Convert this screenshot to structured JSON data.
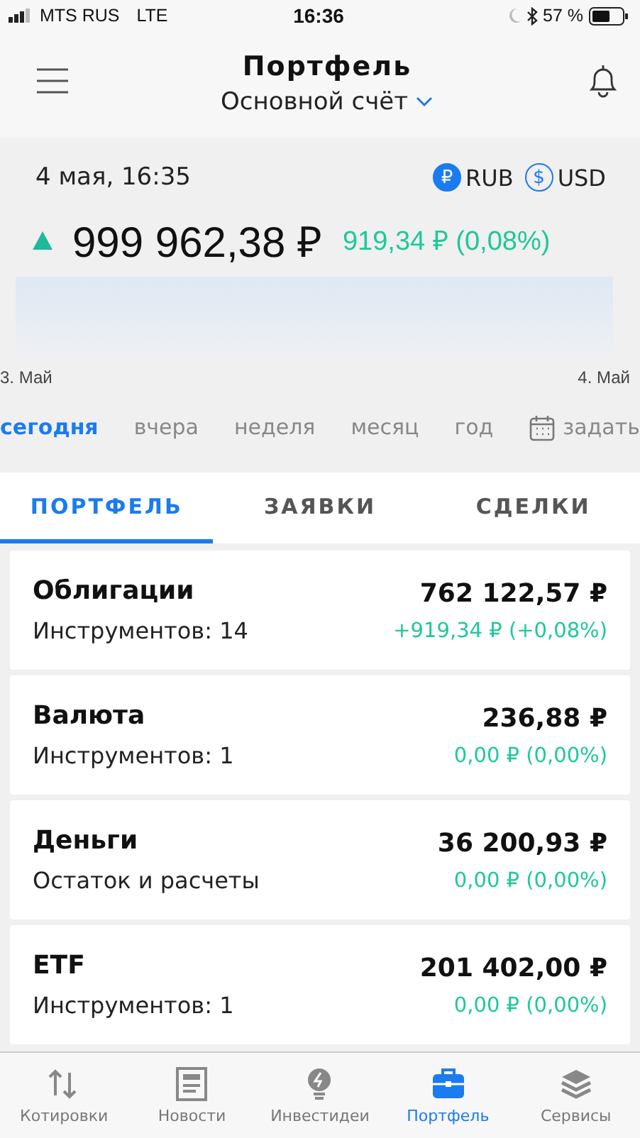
{
  "status_bar": {
    "carrier": "MTS RUS",
    "network": "LTE",
    "time": "16:36",
    "battery": "57 %"
  },
  "header": {
    "title": "Портфель",
    "account": "Основной счёт"
  },
  "summary": {
    "date": "4 мая, 16:35",
    "currencies": [
      {
        "symbol": "₽",
        "label": "RUB",
        "selected": true
      },
      {
        "symbol": "$",
        "label": "USD",
        "selected": false
      }
    ],
    "total": {
      "value": "999 962,38 ₽",
      "change": "919,34 ₽ (0,08%)",
      "kind": "up"
    },
    "axis_labels": [
      "3. Май",
      "4. Май"
    ],
    "periods": [
      {
        "label": "сегодня",
        "selected": true
      },
      {
        "label": "вчера",
        "selected": false
      },
      {
        "label": "неделя",
        "selected": false
      },
      {
        "label": "месяц",
        "selected": false
      },
      {
        "label": "год",
        "selected": false
      },
      {
        "label": "задать",
        "selected": false,
        "kind": "custom"
      }
    ]
  },
  "tabs": [
    {
      "label": "ПОРТФЕЛЬ",
      "selected": true
    },
    {
      "label": "ЗАЯВКИ",
      "selected": false
    },
    {
      "label": "СДЕЛКИ",
      "selected": false
    }
  ],
  "cards": [
    {
      "name": "Облигации",
      "detail": "Инструментов: 14",
      "value": "762 122,57 ₽",
      "change": "+919,34 ₽ (+0,08%)"
    },
    {
      "name": "Валюта",
      "detail": "Инструментов: 1",
      "value": "236,88 ₽",
      "change": "0,00 ₽ (0,00%)"
    },
    {
      "name": "Деньги",
      "detail": "Остаток и расчеты",
      "value": "36 200,93 ₽",
      "change": "0,00 ₽ (0,00%)"
    },
    {
      "name": "ETF",
      "detail": "Инструментов: 1",
      "value": "201 402,00 ₽",
      "change": "0,00 ₽ (0,00%)"
    }
  ],
  "nav": [
    {
      "label": "Котировки",
      "kind": "arrows",
      "selected": false
    },
    {
      "label": "Новости",
      "kind": "news",
      "selected": false
    },
    {
      "label": "Инвестидеи",
      "kind": "bulb",
      "selected": false
    },
    {
      "label": "Портфель",
      "kind": "case",
      "selected": true
    },
    {
      "label": "Сервисы",
      "kind": "layers",
      "selected": false
    }
  ]
}
